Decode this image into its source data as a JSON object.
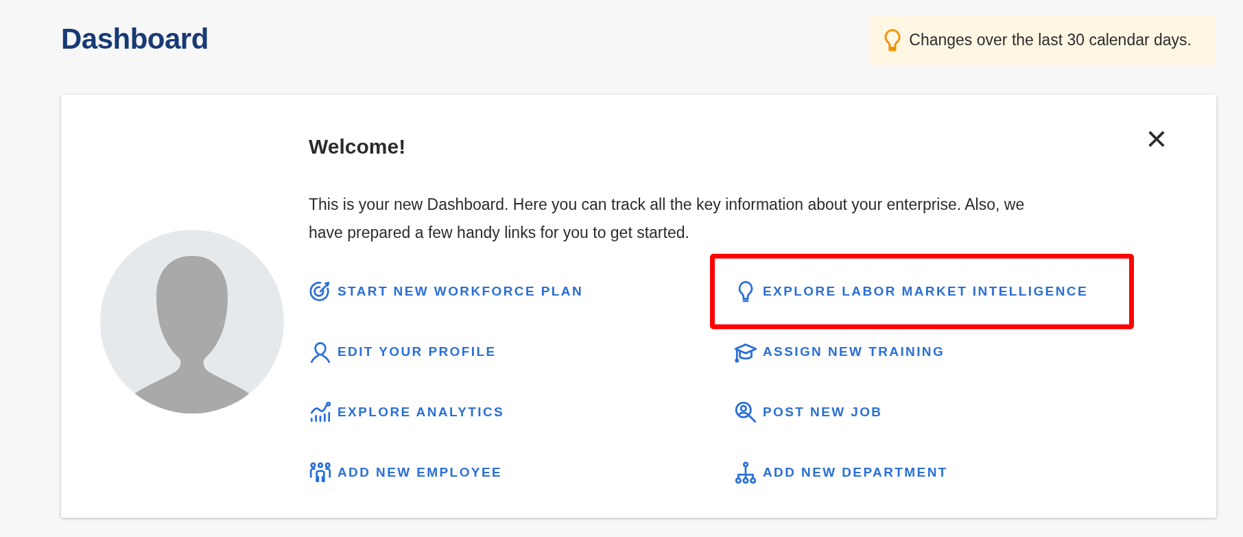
{
  "page_title": "Dashboard",
  "notice": {
    "text": "Changes over the last 30 calendar days."
  },
  "welcome": {
    "title": "Welcome!",
    "close": "×",
    "paragraph": "This is your new Dashboard. Here you can track all the key information about your enterprise. Also, we have prepared a few handy links for you to get started.",
    "links": [
      {
        "label": "START NEW WORKFORCE PLAN",
        "highlighted": false
      },
      {
        "label": "EXPLORE LABOR MARKET INTELLIGENCE",
        "highlighted": true
      },
      {
        "label": "EDIT YOUR PROFILE",
        "highlighted": false
      },
      {
        "label": "ASSIGN NEW TRAINING",
        "highlighted": false
      },
      {
        "label": "EXPLORE ANALYTICS",
        "highlighted": false
      },
      {
        "label": "POST NEW JOB",
        "highlighted": false
      },
      {
        "label": "ADD NEW EMPLOYEE",
        "highlighted": false
      },
      {
        "label": "ADD NEW DEPARTMENT",
        "highlighted": false
      }
    ]
  }
}
